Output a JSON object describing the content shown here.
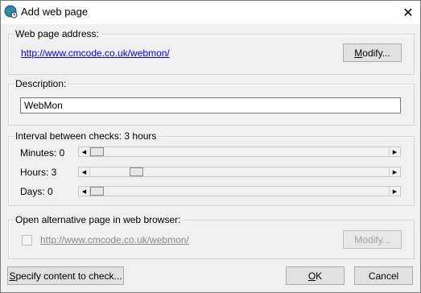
{
  "window": {
    "title": "Add web page",
    "close_glyph": "✕"
  },
  "address_group": {
    "label": "Web page address:",
    "url": "http://www.cmcode.co.uk/webmon/",
    "modify_label": "Modify..."
  },
  "description_group": {
    "label": "Description:",
    "value": "WebMon"
  },
  "interval_group": {
    "label": "Interval between checks: 3 hours",
    "sliders": [
      {
        "label": "Minutes: 0",
        "value": 0
      },
      {
        "label": "Hours: 3",
        "value": 3
      },
      {
        "label": "Days: 0",
        "value": 0
      }
    ]
  },
  "alt_page_group": {
    "label": "Open alternative page in web browser:",
    "checked": false,
    "url": "http://www.cmcode.co.uk/webmon/",
    "modify_label": "Modify..."
  },
  "footer": {
    "specify_label": "Specify content to check...",
    "ok_label": "OK",
    "cancel_label": "Cancel"
  }
}
